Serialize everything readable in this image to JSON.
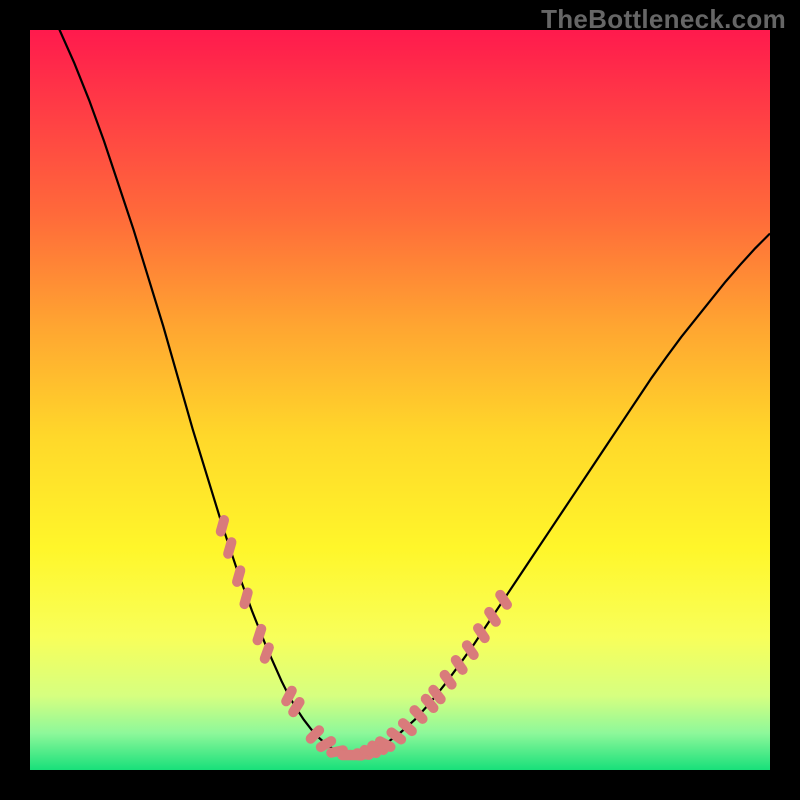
{
  "watermark": "TheBottleneck.com",
  "chart_data": {
    "type": "line",
    "title": "",
    "xlabel": "",
    "ylabel": "",
    "xlim": [
      0,
      100
    ],
    "ylim": [
      0,
      100
    ],
    "background_gradient": {
      "stops": [
        {
          "offset": 0.0,
          "color": "#ff1a4d"
        },
        {
          "offset": 0.1,
          "color": "#ff3a46"
        },
        {
          "offset": 0.25,
          "color": "#ff6a3a"
        },
        {
          "offset": 0.4,
          "color": "#ffa531"
        },
        {
          "offset": 0.55,
          "color": "#ffd82a"
        },
        {
          "offset": 0.7,
          "color": "#fff62a"
        },
        {
          "offset": 0.82,
          "color": "#f8ff5a"
        },
        {
          "offset": 0.9,
          "color": "#d6ff80"
        },
        {
          "offset": 0.95,
          "color": "#8ef89a"
        },
        {
          "offset": 1.0,
          "color": "#18e07a"
        }
      ]
    },
    "series": [
      {
        "name": "bottleneck-curve",
        "stroke": "#000000",
        "x": [
          0,
          2,
          4,
          6,
          8,
          10,
          12,
          14,
          16,
          18,
          20,
          22,
          24,
          26,
          28,
          30,
          32,
          34,
          35,
          36,
          37,
          38,
          39,
          40,
          41,
          42,
          43,
          44,
          46,
          48,
          50,
          52,
          54,
          56,
          58,
          60,
          62,
          64,
          66,
          68,
          70,
          72,
          74,
          76,
          78,
          80,
          82,
          84,
          86,
          88,
          90,
          92,
          94,
          96,
          98,
          100
        ],
        "y": [
          108,
          104,
          100,
          95.5,
          90.5,
          85,
          79,
          73,
          66.5,
          60,
          53,
          46,
          39.5,
          33,
          27,
          21.5,
          16.5,
          12,
          10,
          8.3,
          6.8,
          5.5,
          4.4,
          3.5,
          2.8,
          2.3,
          2,
          2,
          2.5,
          3.5,
          5,
          6.8,
          9,
          11.5,
          14.2,
          17,
          20,
          23,
          26,
          29,
          32,
          35,
          38,
          41,
          44,
          47,
          50,
          53,
          55.8,
          58.5,
          61,
          63.5,
          66,
          68.3,
          70.5,
          72.5
        ]
      }
    ],
    "markers": {
      "name": "pink-dash-markers",
      "color": "#d97b7b",
      "points": [
        {
          "x": 26.0,
          "y": 33.0,
          "angle": -74
        },
        {
          "x": 27.0,
          "y": 30.0,
          "angle": -74
        },
        {
          "x": 28.2,
          "y": 26.2,
          "angle": -74
        },
        {
          "x": 29.2,
          "y": 23.2,
          "angle": -74
        },
        {
          "x": 31.0,
          "y": 18.3,
          "angle": -72
        },
        {
          "x": 32.0,
          "y": 15.8,
          "angle": -70
        },
        {
          "x": 35.0,
          "y": 10.0,
          "angle": -62
        },
        {
          "x": 36.0,
          "y": 8.5,
          "angle": -58
        },
        {
          "x": 38.5,
          "y": 4.8,
          "angle": -45
        },
        {
          "x": 40.0,
          "y": 3.5,
          "angle": -30
        },
        {
          "x": 41.5,
          "y": 2.5,
          "angle": -12
        },
        {
          "x": 43.0,
          "y": 2.0,
          "angle": 0
        },
        {
          "x": 44.0,
          "y": 2.0,
          "angle": 4
        },
        {
          "x": 45.0,
          "y": 2.15,
          "angle": 8
        },
        {
          "x": 46.0,
          "y": 2.5,
          "angle": 15
        },
        {
          "x": 47.0,
          "y": 3.0,
          "angle": 22
        },
        {
          "x": 48.0,
          "y": 3.5,
          "angle": 28
        },
        {
          "x": 49.5,
          "y": 4.6,
          "angle": 36
        },
        {
          "x": 51.0,
          "y": 5.8,
          "angle": 42
        },
        {
          "x": 52.5,
          "y": 7.5,
          "angle": 47
        },
        {
          "x": 54.0,
          "y": 9.0,
          "angle": 50
        },
        {
          "x": 55.0,
          "y": 10.2,
          "angle": 52
        },
        {
          "x": 56.5,
          "y": 12.2,
          "angle": 54
        },
        {
          "x": 58.0,
          "y": 14.2,
          "angle": 55
        },
        {
          "x": 59.5,
          "y": 16.2,
          "angle": 55
        },
        {
          "x": 61.0,
          "y": 18.5,
          "angle": 56
        },
        {
          "x": 62.5,
          "y": 20.7,
          "angle": 56
        },
        {
          "x": 64.0,
          "y": 23.0,
          "angle": 56
        }
      ]
    }
  }
}
